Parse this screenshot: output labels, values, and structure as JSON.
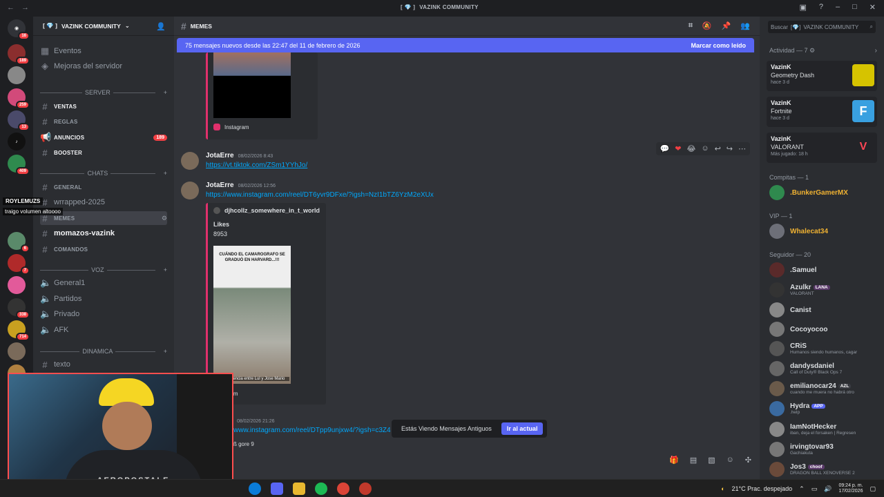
{
  "titlebar": {
    "title": "VAZINK COMMUNITY",
    "glyph": "[ 💎 ]"
  },
  "server": {
    "name": "VAZINK COMMUNITY",
    "prefix": "[ 💎 ]"
  },
  "rail_badges": [
    "16",
    "189",
    "259",
    "13",
    "409",
    "6",
    "7",
    "338",
    "714"
  ],
  "sidebar": {
    "top_items": [
      {
        "label": "Eventos"
      },
      {
        "label": "Mejoras del servidor"
      }
    ],
    "cat_server": "SERVER",
    "cat_chats": "CHATS",
    "cat_voz": "VOZ",
    "cat_dinamica": "DINAMICA",
    "channels": {
      "ventas": "VENTAS",
      "reglas": "REGLAS",
      "anuncios": "ANUNCIOS",
      "anuncios_badge": "189",
      "booster": "BOOSTER",
      "general": "GENERAL",
      "wrapped": "wrrapped-2025",
      "memes": "MEMES",
      "momazos": "momazos-vazink",
      "comandos": "COMANDOS",
      "v_general": "General1",
      "v_partidos": "Partidos",
      "v_privado": "Privado",
      "v_afk": "AFK",
      "texto": "texto"
    }
  },
  "stream_overlay": {
    "name": "ROYLEMUZS",
    "message": "traigo volumen altoooo"
  },
  "channel_header": {
    "name": "MEMES"
  },
  "new_messages_bar": {
    "text": "75 mensajes nuevos desde las 22:47 del 11 de febrero de 2026",
    "action": "Marcar como leído"
  },
  "messages": [
    {
      "embed_provider": "Instagram"
    },
    {
      "author": "JotaErre",
      "time": "08/02/2026 8:43",
      "link": "https://vt.tiktok.com/ZSm1YYhJo/"
    },
    {
      "author": "JotaErre",
      "time": "08/02/2026 12:56",
      "link": "https://www.instagram.com/reel/DT6yvr9DFxe/?igsh=NzI1bTZ6YzM2eXUx",
      "embed_user": "djhcollz_somewhere_in_t_world",
      "embed_likes_label": "Likes",
      "embed_likes": "8953",
      "thumb_text": "CUÁNDO EL CAMAROGRAFO SE GRADUÓ EN HARVARD...!!!",
      "thumb_caption": "competencia entre Lul y Jose Mario",
      "embed_provider": "Instagram"
    },
    {
      "time": "08/02/2026 21:26",
      "link": "www.instagram.com/reel/DTpp9unjxw4/?igsh=c3Z4",
      "preview": "ß gore 9"
    }
  ],
  "jump_bar": {
    "text": "Estás Viendo Mensajes Antiguos",
    "button": "Ir al actual"
  },
  "members": {
    "search_placeholder": "Buscar",
    "search_server": "VAZINK COMMUNITY",
    "activity_title": "Actividad — 7",
    "activity": [
      {
        "user": "VazinK",
        "game": "Geometry Dash",
        "time": "hace 3 d"
      },
      {
        "user": "VazinK",
        "game": "Fortnite",
        "time": "hace 3 d"
      },
      {
        "user": "VazinK",
        "game": "VALORANT",
        "time": "Más jugado: 18 h"
      }
    ],
    "group_compitas": "Compitas — 1",
    "compitas": [
      {
        "name": ".BunkerGamerMX"
      }
    ],
    "group_vip": "VIP — 1",
    "vip": [
      {
        "name": "Whalecat34"
      }
    ],
    "group_seguidor": "Seguidor — 20",
    "seguidores": [
      {
        "name": ".Samuel",
        "sub": ""
      },
      {
        "name": "Azulkr",
        "tag": "LANA",
        "sub": "VALORANT"
      },
      {
        "name": "Canist",
        "sub": ""
      },
      {
        "name": "Cocoyocoo",
        "sub": ""
      },
      {
        "name": "CRiS",
        "sub": "Humanos siendo humanos, cagar"
      },
      {
        "name": "dandysdaniel",
        "sub": "Call of Duty® Black Ops 7"
      },
      {
        "name": "emilianocar24",
        "tag": "AZL",
        "sub": "cuando me muera no habrá otro"
      },
      {
        "name": "Hydra",
        "tag": "APP",
        "sub": ".help"
      },
      {
        "name": "IamNotHecker",
        "sub": "iban, deja el forsaken | Regresen"
      },
      {
        "name": "irvingtovar93",
        "sub": "Gachiakuta"
      },
      {
        "name": "Jos3",
        "tag": "choof",
        "sub": "DRAGON BALL XENOVERSE 2"
      }
    ]
  },
  "webcam": {
    "shirt_text": "AEROPOSTALE"
  },
  "taskbar": {
    "weather": "21°C  Prac. despejado",
    "time": "09:24 p. m.",
    "date": "17/02/2026"
  },
  "colors": {
    "accent": "#5865f2",
    "link": "#00a8fc",
    "mention": "#f23f43"
  }
}
